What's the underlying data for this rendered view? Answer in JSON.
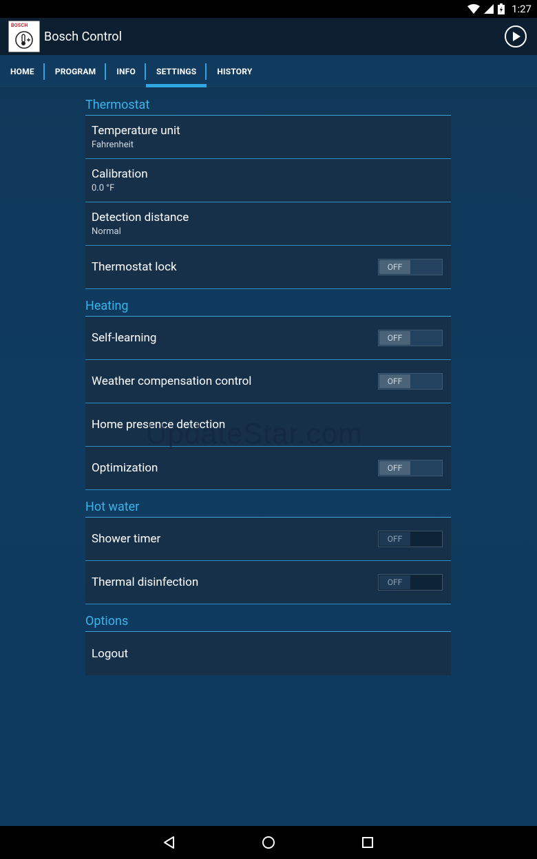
{
  "status_bar": {
    "time": "1:27"
  },
  "app_bar": {
    "title": "Bosch Control",
    "logo_text": "BOSCH"
  },
  "tabs": [
    {
      "label": "HOME",
      "active": false
    },
    {
      "label": "PROGRAM",
      "active": false
    },
    {
      "label": "INFO",
      "active": false
    },
    {
      "label": "SETTINGS",
      "active": true
    },
    {
      "label": "HISTORY",
      "active": false
    }
  ],
  "sections": {
    "thermostat": {
      "header": "Thermostat",
      "temperature_unit": {
        "title": "Temperature unit",
        "value": "Fahrenheit"
      },
      "calibration": {
        "title": "Calibration",
        "value": "0.0 °F"
      },
      "detection_distance": {
        "title": "Detection distance",
        "value": "Normal"
      },
      "thermostat_lock": {
        "title": "Thermostat lock",
        "toggle": "OFF"
      }
    },
    "heating": {
      "header": "Heating",
      "self_learning": {
        "title": "Self-learning",
        "toggle": "OFF"
      },
      "weather_compensation": {
        "title": "Weather compensation control",
        "toggle": "OFF"
      },
      "home_presence": {
        "title": "Home presence detection"
      },
      "optimization": {
        "title": "Optimization",
        "toggle": "OFF"
      }
    },
    "hot_water": {
      "header": "Hot water",
      "shower_timer": {
        "title": "Shower timer",
        "toggle": "OFF"
      },
      "thermal_disinfection": {
        "title": "Thermal disinfection",
        "toggle": "OFF"
      }
    },
    "options": {
      "header": "Options",
      "logout": {
        "title": "Logout"
      }
    }
  },
  "watermark": "UpdateStar.com",
  "colors": {
    "accent": "#2fa6e0",
    "section_header": "#3fb2e8",
    "row_bg": "#16304a",
    "background": "#0f3a5e"
  }
}
